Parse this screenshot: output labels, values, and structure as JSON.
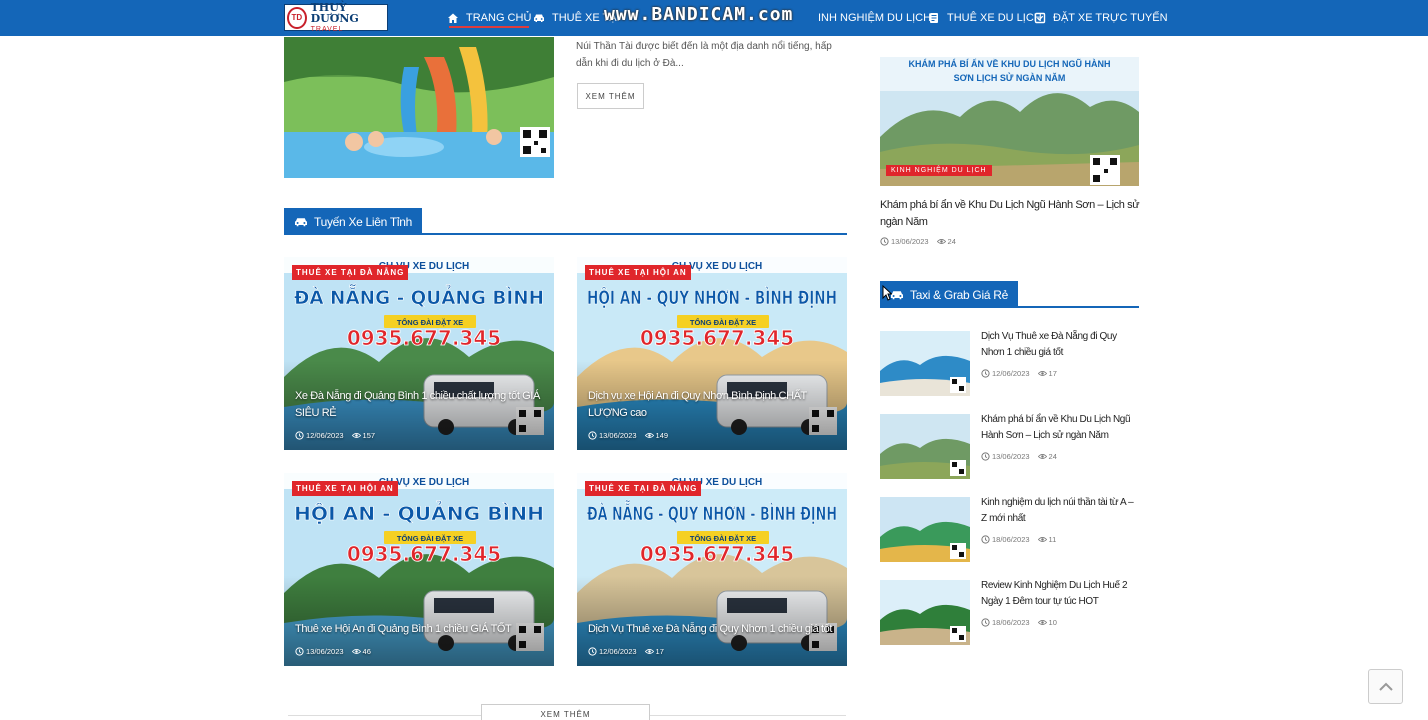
{
  "logo": {
    "name": "THUỲ DƯƠNG",
    "sub": "TRAVEL"
  },
  "watermark": "www.BANDICAM.com",
  "nav": [
    {
      "label": "TRANG CHỦ",
      "icon": "home-icon",
      "active": true
    },
    {
      "label": "THUÊ XE TẠI",
      "icon": "car-icon"
    },
    {
      "label": "INH NGHIỆM DU LỊCH",
      "icon": "book-icon"
    },
    {
      "label": "THUÊ XE DU LỊCH",
      "icon": "document-icon"
    },
    {
      "label": "ĐẶT XE TRỰC TUYẾN",
      "icon": "checkbox-icon"
    }
  ],
  "hero": {
    "excerpt": "Núi Thần Tài được biết đến là một địa danh nổi tiếng, hấp dẫn khi đi du lịch ở Đà...",
    "more_label": "XEM THÊM"
  },
  "section_routes": {
    "title": "Tuyến Xe Liên Tỉnh",
    "cards": [
      {
        "badge": "THUÊ XE TẠI ĐÀ NẴNG",
        "route": "ĐÀ NẴNG - QUẢNG BÌNH",
        "title": "Xe Đà Nẵng đi Quảng Bình 1 chiều chất lượng tốt GIÁ SIÊU RẺ",
        "date": "12/06/2023",
        "views": "157",
        "phone": "0935.677.345"
      },
      {
        "badge": "THUÊ XE TẠI HỘI AN",
        "route": "HỘI AN - QUY NHƠN - BÌNH ĐỊNH",
        "title": "Dịch vụ xe Hội An đi Quy Nhơn Bình Định CHẤT LƯỢNG cao",
        "date": "13/06/2023",
        "views": "149",
        "phone": "0935.677.345"
      },
      {
        "badge": "THUÊ XE TẠI HỘI AN",
        "route": "HỘI AN - QUẢNG BÌNH",
        "title": "Thuê xe Hội An đi Quảng Bình 1 chiều GIÁ TỐT",
        "date": "13/06/2023",
        "views": "46",
        "phone": "0935.677.345"
      },
      {
        "badge": "THUÊ XE TẠI ĐÀ NẴNG",
        "route": "ĐÀ NẴNG - QUY NHƠN - BÌNH ĐỊNH",
        "title": "Dịch Vụ Thuê xe Đà Nẵng đi Quy Nhơn 1 chiều giá tốt",
        "date": "12/06/2023",
        "views": "17",
        "phone": "0935.677.345"
      }
    ],
    "card_banner": "CH VỤ XE DU LỊCH",
    "card_hotline": "TỔNG ĐÀI ĐẶT XE",
    "more_label": "XEM THÊM"
  },
  "sidebar": {
    "feature": {
      "image_caption": "KHÁM PHÁ BÍ ẨN VỀ KHU DU LỊCH NGŨ HÀNH SƠN LỊCH SỬ NGÀN NĂM",
      "badge": "KINH NGHIỆM DU LỊCH",
      "title": "Khám phá bí ẩn về Khu Du Lịch Ngũ Hành Sơn – Lịch sử ngàn Năm",
      "date": "13/06/2023",
      "views": "24"
    },
    "section_title": "Taxi & Grab Giá Rẻ",
    "items": [
      {
        "title": "Dịch Vụ Thuê xe Đà Nẵng đi Quy Nhơn 1 chiều giá tốt",
        "date": "12/06/2023",
        "views": "17"
      },
      {
        "title": "Khám phá bí ẩn về Khu Du Lịch Ngũ Hành Sơn – Lịch sử ngàn Năm",
        "date": "13/06/2023",
        "views": "24"
      },
      {
        "title": "Kinh nghiệm du lịch núi thần tài từ A – Z mới nhất",
        "date": "18/06/2023",
        "views": "11"
      },
      {
        "title": "Review Kinh Nghiệm Du Lịch Huế 2 Ngày 1 Đêm tour tự túc HOT",
        "date": "18/06/2023",
        "views": "10"
      }
    ]
  },
  "colors": {
    "brand": "#1466b8",
    "badge": "#e0262b"
  }
}
